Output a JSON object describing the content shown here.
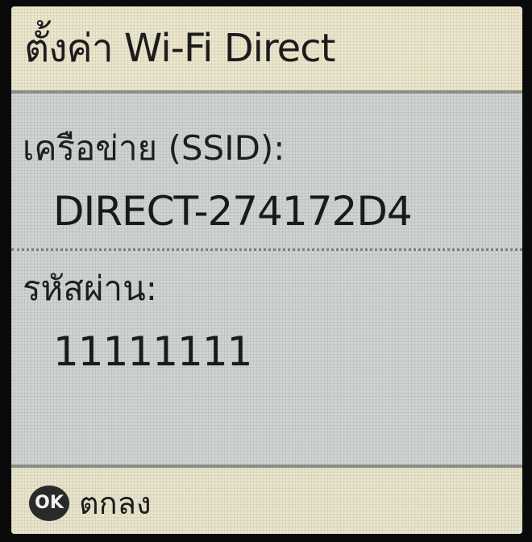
{
  "header": {
    "title": "ตั้งค่า Wi-Fi Direct"
  },
  "network": {
    "ssid_label": "เครือข่าย (SSID):",
    "ssid_value": "DIRECT-274172D4",
    "password_label": "รหัสผ่าน:",
    "password_value": "11111111"
  },
  "footer": {
    "ok_icon_text": "OK",
    "ok_icon": "ok-button-icon",
    "ok_label": "ตกลง"
  },
  "colors": {
    "title_bg": "#ece6cc",
    "content_bg": "#cfd3d2",
    "footer_bg": "#e9e4cc",
    "text": "#1c1c1c"
  }
}
